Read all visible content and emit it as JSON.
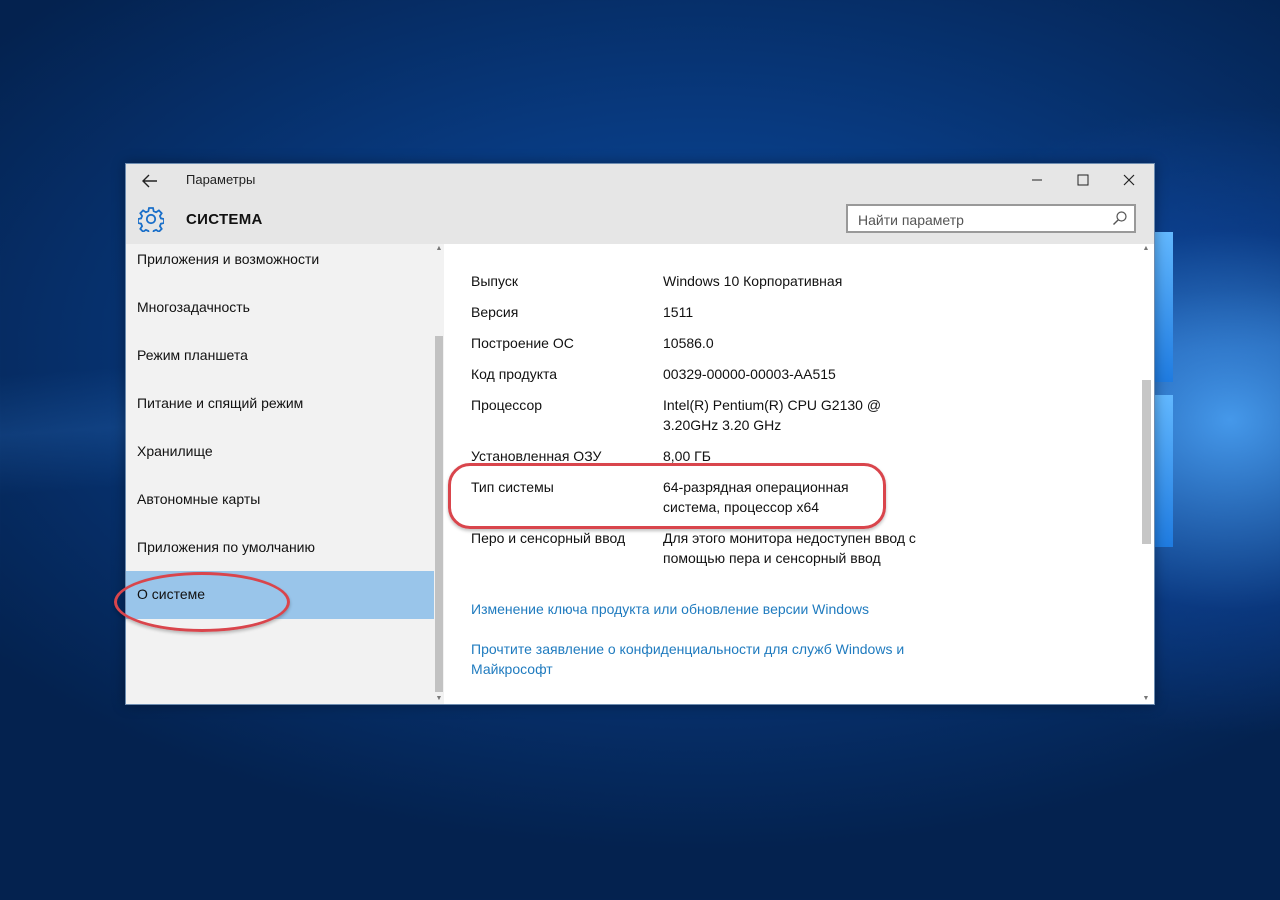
{
  "window": {
    "app_title": "Параметры",
    "section_title": "СИСТЕМА",
    "search_placeholder": "Найти параметр"
  },
  "sidebar": {
    "items": [
      {
        "label": "Приложения и возможности",
        "selected": false
      },
      {
        "label": "Многозадачность",
        "selected": false
      },
      {
        "label": "Режим планшета",
        "selected": false
      },
      {
        "label": "Питание и спящий режим",
        "selected": false
      },
      {
        "label": "Хранилище",
        "selected": false
      },
      {
        "label": "Автономные карты",
        "selected": false
      },
      {
        "label": "Приложения по умолчанию",
        "selected": false
      },
      {
        "label": "О системе",
        "selected": true
      }
    ]
  },
  "about": {
    "rows": [
      {
        "key": "Выпуск",
        "value": "Windows 10 Корпоративная"
      },
      {
        "key": "Версия",
        "value": "1511"
      },
      {
        "key": "Построение ОС",
        "value": "10586.0"
      },
      {
        "key": "Код продукта",
        "value": "00329-00000-00003-AA515"
      },
      {
        "key": "Процессор",
        "value": "Intel(R) Pentium(R) CPU G2130 @ 3.20GHz   3.20 GHz"
      },
      {
        "key": "Установленная ОЗУ",
        "value": "8,00 ГБ"
      },
      {
        "key": "Тип системы",
        "value": "64-разрядная операционная система, процессор x64"
      },
      {
        "key": "Перо и сенсорный ввод",
        "value": "Для этого монитора недоступен ввод с помощью пера и сенсорный ввод"
      }
    ],
    "links": [
      "Изменение ключа продукта или обновление версии Windows",
      "Прочтите заявление о конфиденциальности для служб Windows и Майкрософт"
    ]
  },
  "colors": {
    "selection": "#99c5ea",
    "link": "#1f7bbf",
    "annotation": "#d9454c",
    "accent_icon": "#1a6fc9"
  },
  "icons": {
    "back": "arrow-left-icon",
    "minimize": "minimize-icon",
    "maximize": "maximize-icon",
    "close": "close-icon",
    "section": "gear-icon",
    "search": "search-icon"
  }
}
